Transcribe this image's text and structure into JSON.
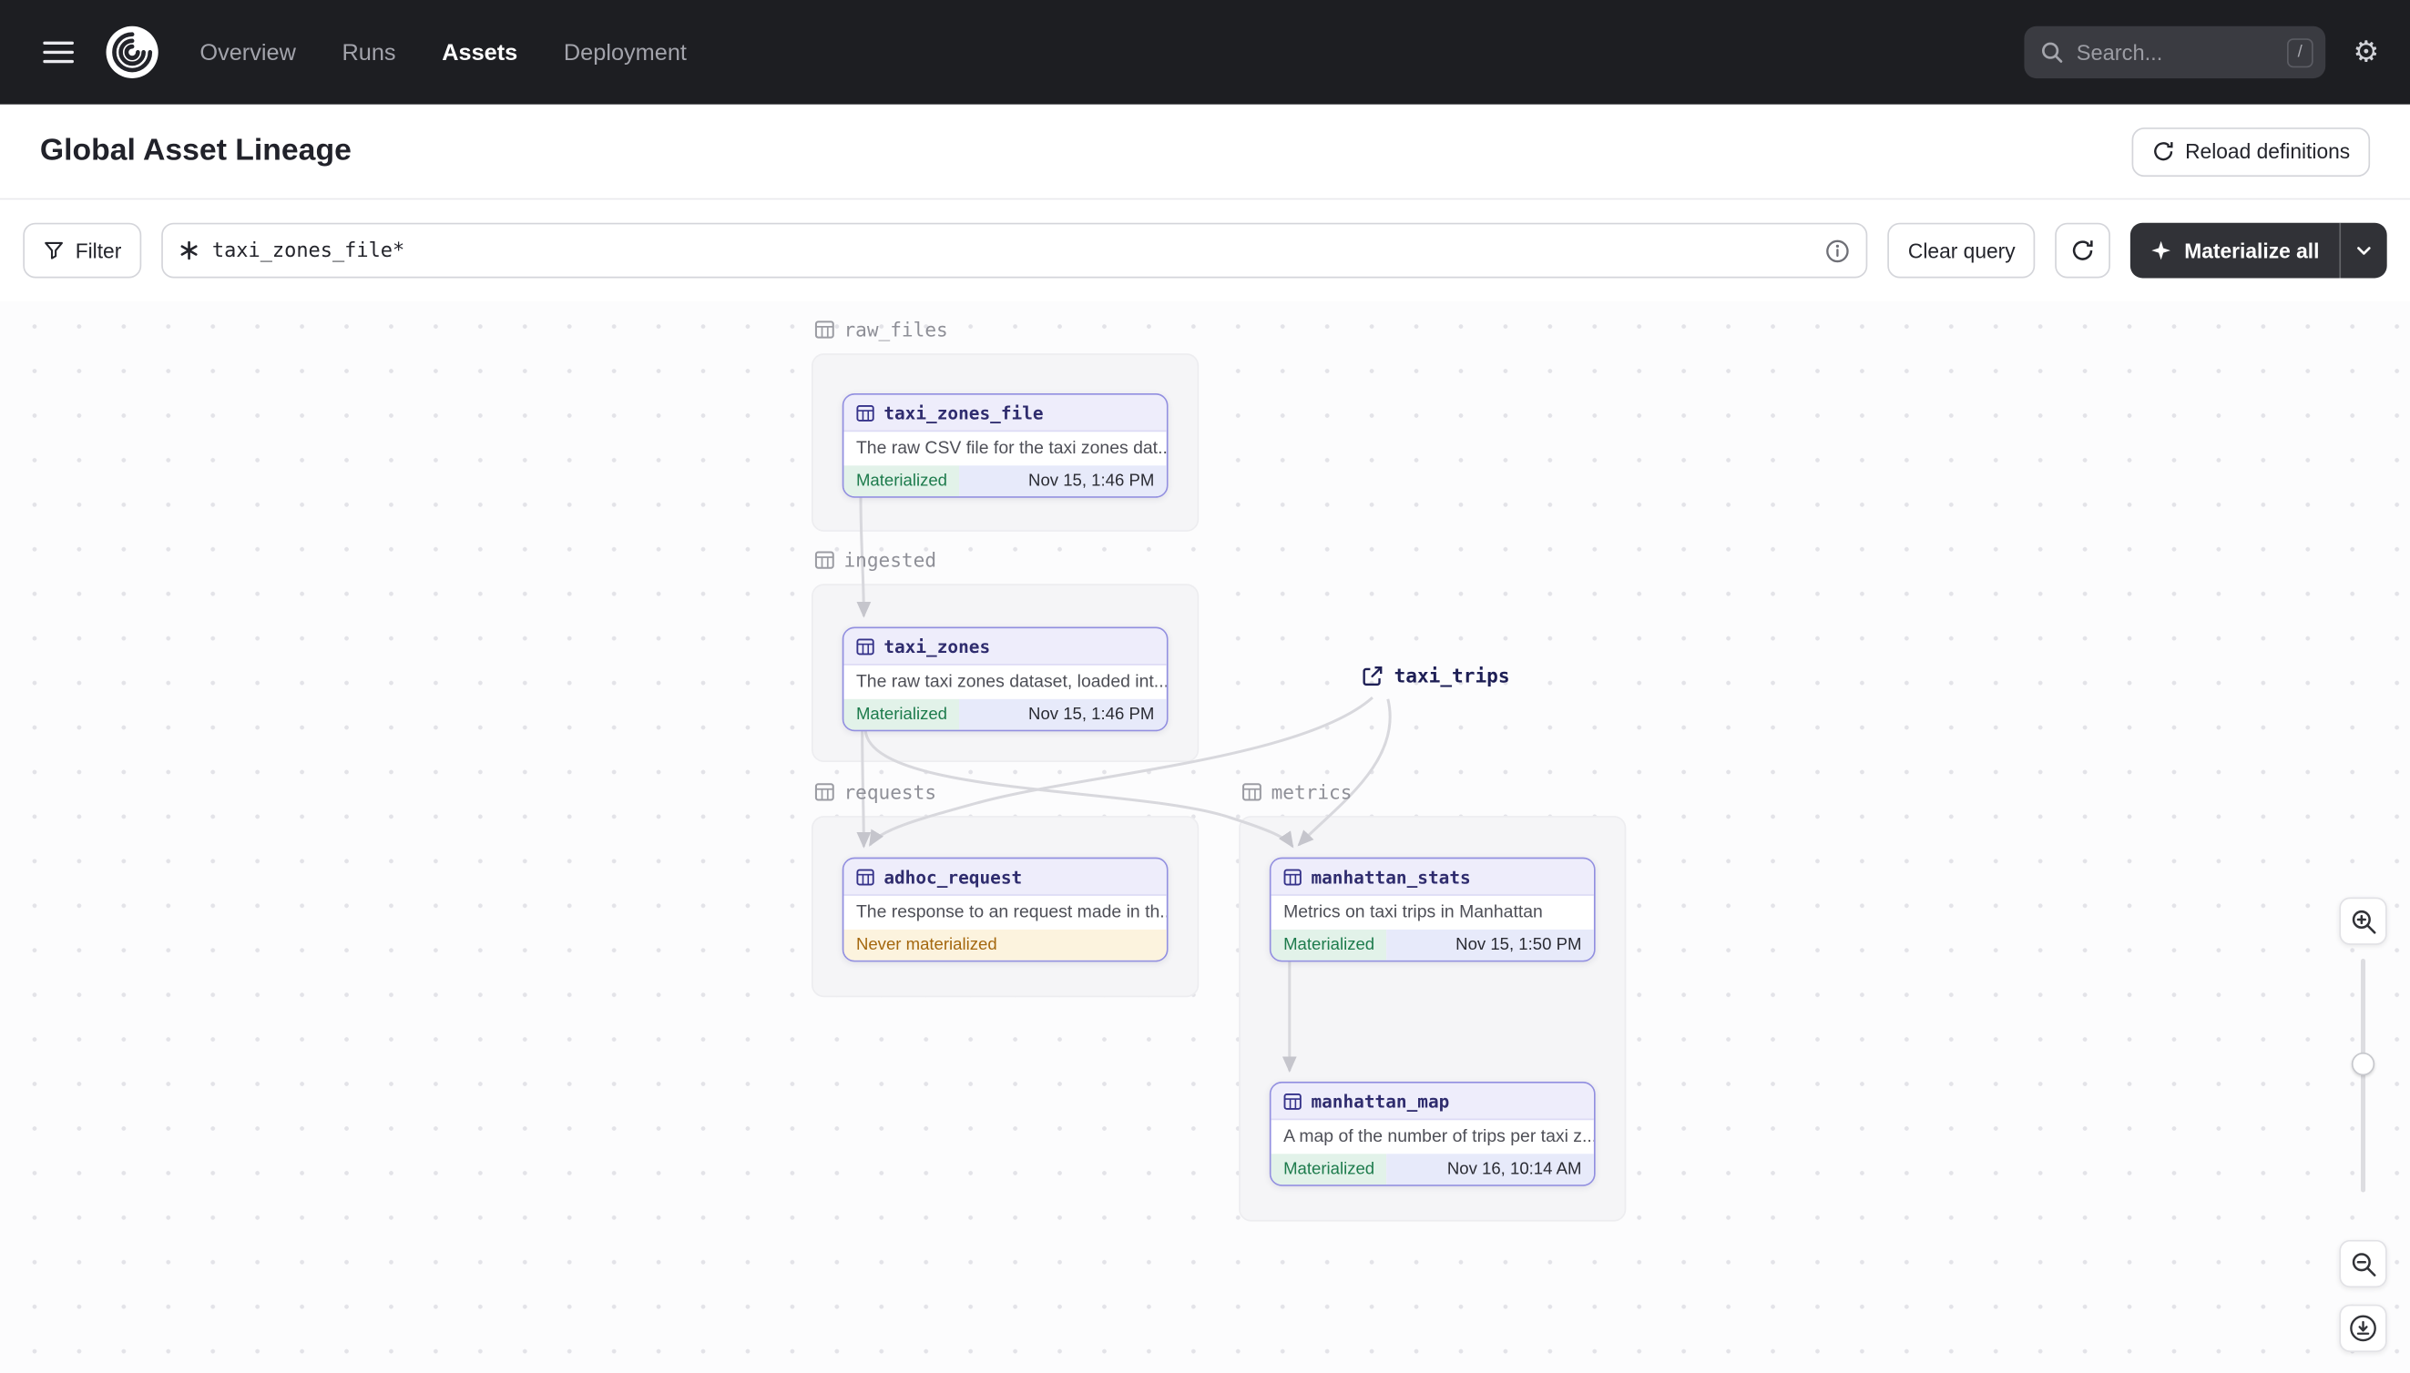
{
  "topnav": {
    "nav": [
      {
        "label": "Overview",
        "active": false
      },
      {
        "label": "Runs",
        "active": false
      },
      {
        "label": "Assets",
        "active": true
      },
      {
        "label": "Deployment",
        "active": false
      }
    ],
    "search": {
      "placeholder": "Search...",
      "shortcut": "/"
    }
  },
  "header": {
    "title": "Global Asset Lineage",
    "reload_label": "Reload definitions"
  },
  "toolbar": {
    "filter_label": "Filter",
    "query_value": "taxi_zones_file*",
    "clear_label": "Clear query",
    "materialize_label": "Materialize all"
  },
  "lineage": {
    "groups": [
      {
        "name": "raw_files"
      },
      {
        "name": "ingested"
      },
      {
        "name": "requests"
      },
      {
        "name": "metrics"
      }
    ],
    "nodes": [
      {
        "name": "taxi_zones_file",
        "group": "raw_files",
        "description": "The raw CSV file for the taxi zones dat...",
        "status": "Materialized",
        "timestamp": "Nov 15, 1:46 PM"
      },
      {
        "name": "taxi_zones",
        "group": "ingested",
        "description": "The raw taxi zones dataset, loaded int...",
        "status": "Materialized",
        "timestamp": "Nov 15, 1:46 PM"
      },
      {
        "name": "adhoc_request",
        "group": "requests",
        "description": "The response to an request made in th...",
        "status": "Never materialized"
      },
      {
        "name": "manhattan_stats",
        "group": "metrics",
        "description": "Metrics on taxi trips in Manhattan",
        "status": "Materialized",
        "timestamp": "Nov 15, 1:50 PM"
      },
      {
        "name": "manhattan_map",
        "group": "metrics",
        "description": "A map of the number of trips per taxi z...",
        "status": "Materialized",
        "timestamp": "Nov 16, 10:14 AM"
      }
    ],
    "external_assets": [
      {
        "name": "taxi_trips"
      }
    ]
  },
  "colors": {
    "topbar_bg": "#1d1e22",
    "accent_purple": "#928fe0",
    "node_header_bg": "#eeedfb",
    "materialized_green": "#1d7b4c",
    "never_materialized_orange": "#a4670e",
    "edge_gray": "#d8d8dd"
  },
  "icons": {
    "menu-icon": "hamburger-lines",
    "dagster-logo": "spiral-shell",
    "search-icon": "magnifier",
    "gear-icon": "gear",
    "filter-icon": "funnel",
    "query-syntax-icon": "asterisk",
    "info-icon": "circle-i",
    "reload-icon": "circular-arrow",
    "refresh-icon": "circular-arrow",
    "materialize-icon": "four-point-star",
    "caret-down-icon": "chevron-down",
    "asset-table-icon": "grid-table",
    "group-table-icon": "grid-table",
    "external-link-icon": "arrow-out-of-box",
    "zoom-in-icon": "magnifier-plus",
    "zoom-out-icon": "magnifier-minus",
    "download-icon": "arrow-into-tray"
  }
}
